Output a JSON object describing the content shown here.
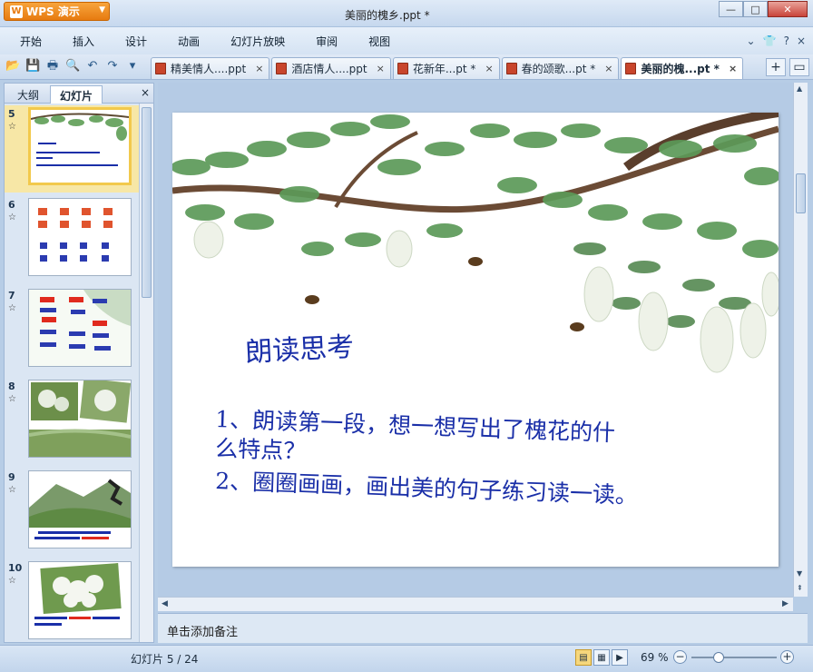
{
  "app": {
    "button_label": "WPS 演示",
    "window_title": "美丽的槐乡.ppt *"
  },
  "menu": [
    "开始",
    "插入",
    "设计",
    "动画",
    "幻灯片放映",
    "审阅",
    "视图"
  ],
  "doc_tabs": [
    {
      "label": "精美情人....ppt",
      "close": "×"
    },
    {
      "label": "酒店情人....ppt",
      "close": "×"
    },
    {
      "label": "花新年...pt *",
      "close": "×"
    },
    {
      "label": "春的颂歌...pt *",
      "close": "×"
    },
    {
      "label": "美丽的槐...pt *",
      "close": "×"
    }
  ],
  "left_panel": {
    "tab_outline": "大纲",
    "tab_slides": "幻灯片",
    "close": "×",
    "thumbnails": [
      {
        "num": "5",
        "star": "☆"
      },
      {
        "num": "6",
        "star": "☆"
      },
      {
        "num": "7",
        "star": "☆"
      },
      {
        "num": "8",
        "star": "☆"
      },
      {
        "num": "9",
        "star": "☆"
      },
      {
        "num": "10",
        "star": "☆"
      }
    ]
  },
  "slide": {
    "title": "朗读思考",
    "line1": "1、朗读第一段，想一想写出了槐花的什",
    "line2": "么特点？",
    "line3": "2、圈圈画画，画出美的句子练习读一读。"
  },
  "notes_placeholder": "单击添加备注",
  "status": {
    "slide_counter": "幻灯片 5 / 24",
    "zoom": "69 %"
  },
  "colors": {
    "slide_text": "#1a2fa8",
    "wps_orange": "#e77b10"
  }
}
